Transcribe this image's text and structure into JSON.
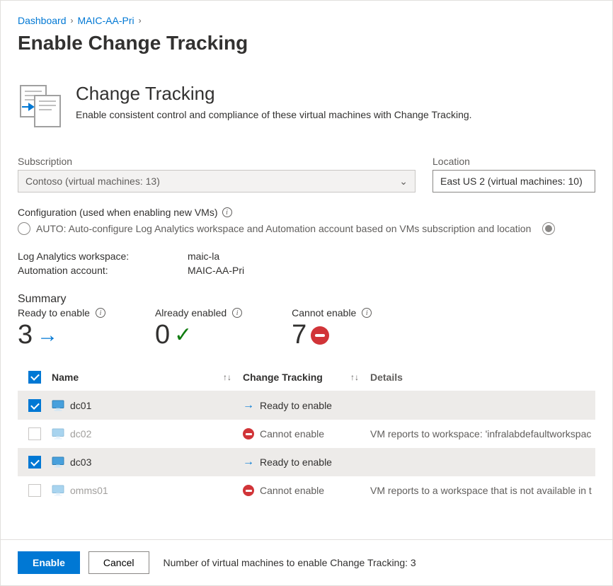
{
  "breadcrumb": {
    "items": [
      "Dashboard",
      "MAIC-AA-Pri"
    ]
  },
  "page_title": "Enable Change Tracking",
  "header": {
    "title": "Change Tracking",
    "description": "Enable consistent control and compliance of these virtual machines with Change Tracking."
  },
  "fields": {
    "subscription_label": "Subscription",
    "subscription_value": "Contoso  (virtual machines: 13)",
    "location_label": "Location",
    "location_value": "East US 2 (virtual machines: 10)"
  },
  "configuration": {
    "label": "Configuration (used when enabling new VMs)",
    "option_auto": "AUTO: Auto-configure Log Analytics workspace and Automation account based on VMs subscription and location"
  },
  "workspace": {
    "law_label": "Log Analytics workspace:",
    "law_value": "maic-la",
    "aa_label": "Automation account:",
    "aa_value": "MAIC-AA-Pri"
  },
  "summary": {
    "label": "Summary",
    "ready_label": "Ready to enable",
    "ready_value": "3",
    "already_label": "Already enabled",
    "already_value": "0",
    "cannot_label": "Cannot enable",
    "cannot_value": "7"
  },
  "table": {
    "col_name": "Name",
    "col_status": "Change Tracking",
    "col_details": "Details",
    "status_ready": "Ready to enable",
    "status_cannot": "Cannot enable",
    "rows": [
      {
        "name": "dc01",
        "status": "ready",
        "details": "",
        "checked": true
      },
      {
        "name": "dc02",
        "status": "cannot",
        "details": "VM reports to workspace: 'infralabdefaultworkspac",
        "checked": false
      },
      {
        "name": "dc03",
        "status": "ready",
        "details": "",
        "checked": true
      },
      {
        "name": "omms01",
        "status": "cannot",
        "details": "VM reports to a workspace that is not available in t",
        "checked": false
      }
    ]
  },
  "footer": {
    "enable": "Enable",
    "cancel": "Cancel",
    "status": "Number of virtual machines to enable Change Tracking: 3"
  }
}
